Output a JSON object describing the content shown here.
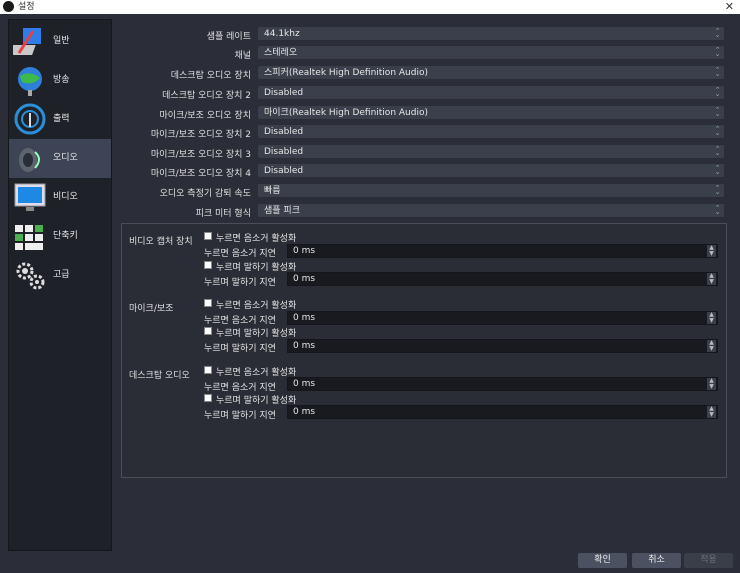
{
  "window": {
    "title": "설정",
    "close": "✕"
  },
  "sidebar": {
    "items": [
      {
        "label": "일반",
        "icon": "general-icon"
      },
      {
        "label": "방송",
        "icon": "stream-icon"
      },
      {
        "label": "출력",
        "icon": "output-icon"
      },
      {
        "label": "오디오",
        "icon": "audio-icon",
        "active": true
      },
      {
        "label": "비디오",
        "icon": "video-icon"
      },
      {
        "label": "단축키",
        "icon": "hotkeys-icon"
      },
      {
        "label": "고급",
        "icon": "advanced-icon"
      }
    ]
  },
  "audio": {
    "rows": [
      {
        "label": "샘플 레이트",
        "value": "44.1khz"
      },
      {
        "label": "채널",
        "value": "스테레오"
      },
      {
        "label": "데스크탑 오디오 장치",
        "value": "스피커(Realtek High Definition Audio)"
      },
      {
        "label": "데스크탑 오디오 장치 2",
        "value": "Disabled"
      },
      {
        "label": "마이크/보조 오디오 장치",
        "value": "마이크(Realtek High Definition Audio)"
      },
      {
        "label": "마이크/보조 오디오 장치 2",
        "value": "Disabled"
      },
      {
        "label": "마이크/보조 오디오 장치 3",
        "value": "Disabled"
      },
      {
        "label": "마이크/보조 오디오 장치 4",
        "value": "Disabled"
      },
      {
        "label": "오디오 측정기 감퇴 속도",
        "value": "빠름"
      },
      {
        "label": "피크 미터 형식",
        "value": "샘플 피크"
      }
    ]
  },
  "hotkey_groups": [
    {
      "label": "비디오 캡처 장치",
      "ptm_check": "누르면 음소거 활성화",
      "ptm_delay_label": "누르면 음소거 지연",
      "ptm_delay": "0 ms",
      "ptt_check": "누르며 말하기 활성화",
      "ptt_delay_label": "누르며 말하기 지연",
      "ptt_delay": "0 ms"
    },
    {
      "label": "마이크/보조",
      "ptm_check": "누르면 음소거 활성화",
      "ptm_delay_label": "누르면 음소거 지연",
      "ptm_delay": "0 ms",
      "ptt_check": "누르며 말하기 활성화",
      "ptt_delay_label": "누르며 말하기 지연",
      "ptt_delay": "0 ms"
    },
    {
      "label": "데스크탑 오디오",
      "ptm_check": "누르면 음소거 활성화",
      "ptm_delay_label": "누르면 음소거 지연",
      "ptm_delay": "0 ms",
      "ptt_check": "누르며 말하기 활성화",
      "ptt_delay_label": "누르며 말하기 지연",
      "ptt_delay": "0 ms"
    }
  ],
  "buttons": {
    "ok": "확인",
    "cancel": "취소",
    "apply": "적용"
  }
}
